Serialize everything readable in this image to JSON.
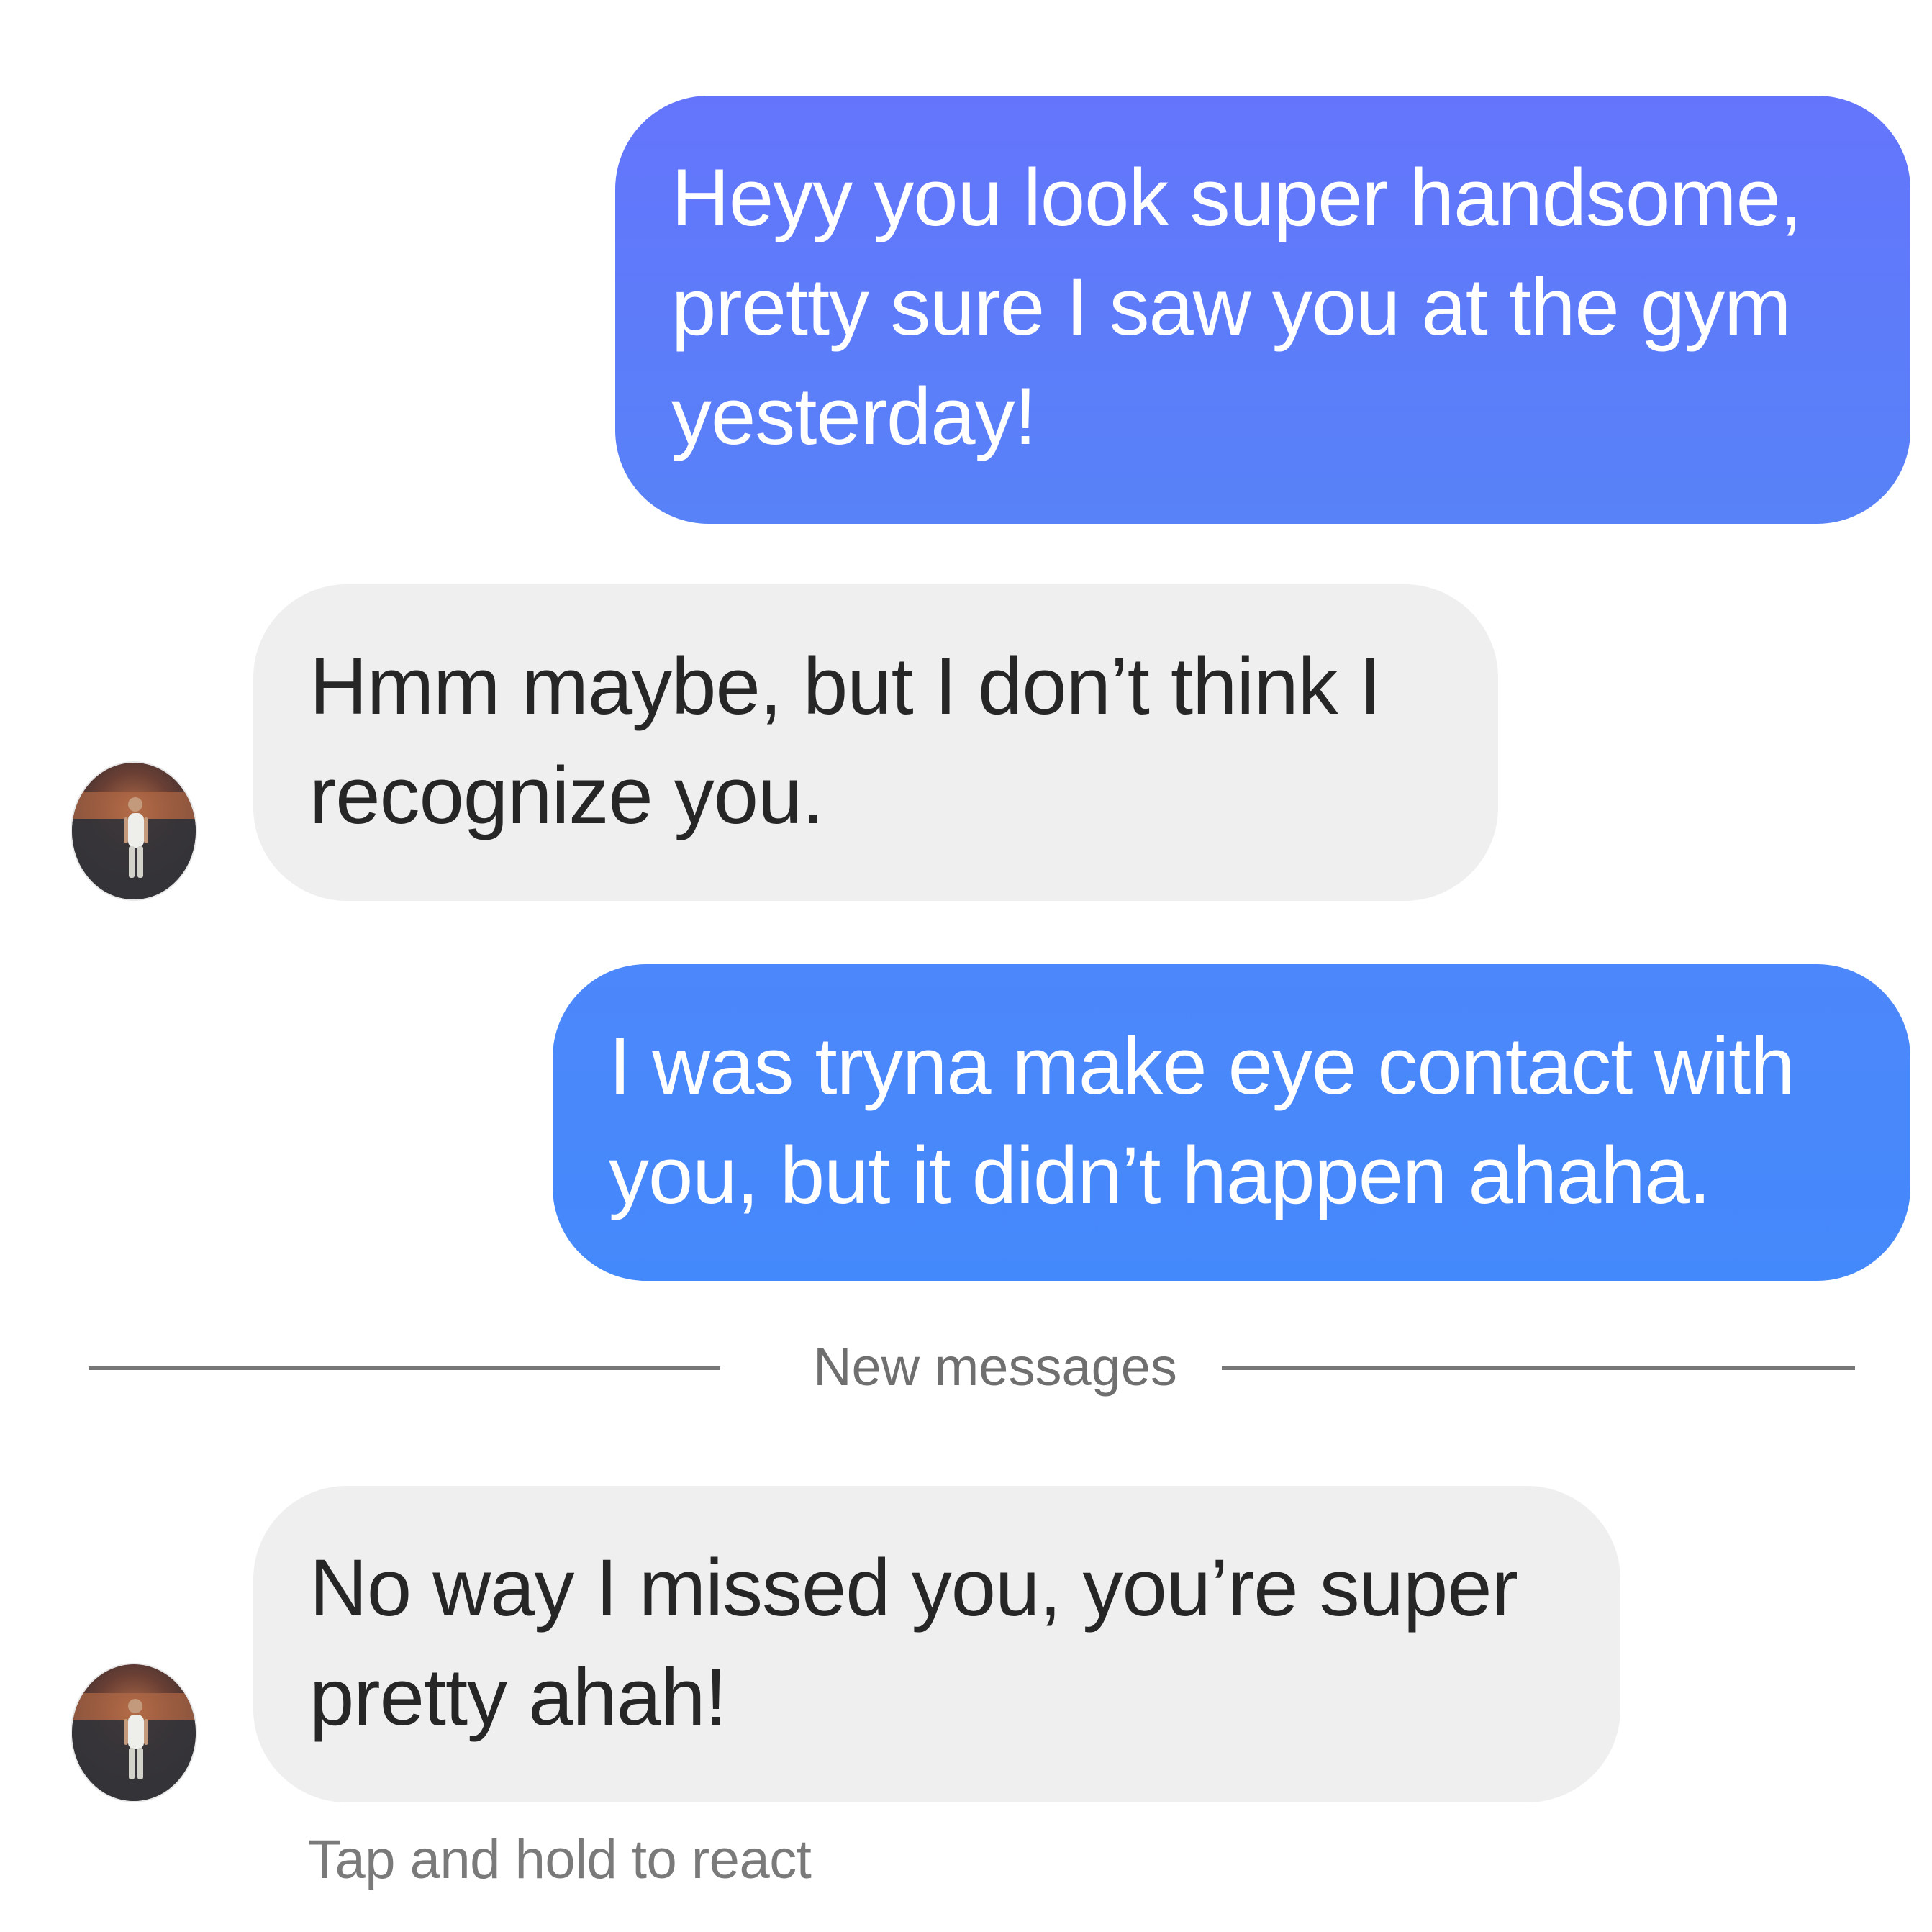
{
  "chat": {
    "top_timestamp": "— — —",
    "messages": [
      {
        "sender": "outgoing",
        "text": "Heyy you look super handsome,\npretty sure I saw you at the gym\nyesterday!"
      },
      {
        "sender": "incoming",
        "text": "Hmm maybe, but I don’t think I\nrecognize you."
      },
      {
        "sender": "outgoing",
        "text": "I was tryna make eye contact with\nyou, but it didn’t happen ahaha."
      },
      {
        "sender": "incoming",
        "text": "No way I missed you, you’re super\npretty ahah!"
      }
    ],
    "divider_label": "New messages",
    "hint": "Tap and hold to react",
    "avatar_icon": "profile-photo-avatar",
    "colors": {
      "outgoing_top": "#6475fc",
      "outgoing_bottom": "#4489fb",
      "incoming_bg": "#efefef",
      "divider_line": "#777777",
      "hint_text": "#7a7a7a"
    }
  }
}
